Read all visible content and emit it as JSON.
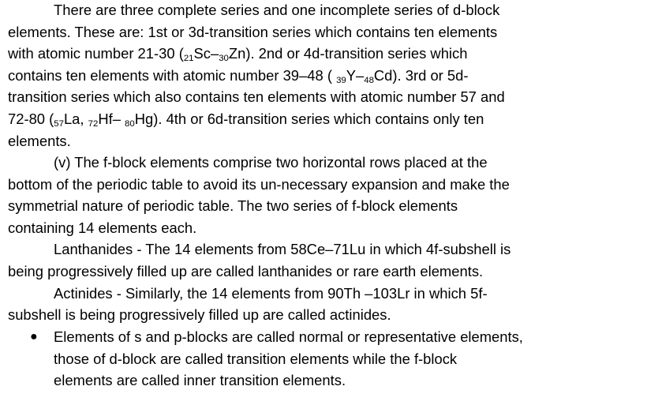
{
  "paragraph1": {
    "l1": "There are three complete series and one incomplete series of d-block",
    "l2": "elements. These are: 1st or 3d-transition series which contains ten elements",
    "l3_a": "with atomic number 21-30 (",
    "l3_s1": "21",
    "l3_b": "Sc–",
    "l3_s2": "30",
    "l3_c": "Zn). 2nd or 4d-transition series which",
    "l4_a": "contains ten elements with atomic number 39–48 ( ",
    "l4_s1": "39",
    "l4_b": "Y–",
    "l4_s2": "48",
    "l4_c": "Cd). 3rd or 5d-",
    "l5": "transition series which also contains ten elements with atomic number 57 and",
    "l6_a": "72-80 (",
    "l6_s1": "57",
    "l6_b": "La, ",
    "l6_s2": "72",
    "l6_c": "Hf– ",
    "l6_s3": "80",
    "l6_d": "Hg). 4th or 6d-transition series which contains only ten",
    "l7": "elements."
  },
  "paragraph2": {
    "l1": "(v) The f-block elements comprise two horizontal rows placed at the",
    "l2": "bottom of the periodic table to avoid its un-necessary expansion and make the",
    "l3": "symmetrial nature of periodic table. The two series of f-block elements",
    "l4": "containing 14 elements each."
  },
  "paragraph3": {
    "l1": "Lanthanides - The 14 elements from 58Ce–71Lu in which 4f-subshell is",
    "l2": "being progressively filled up are called lanthanides or rare earth elements."
  },
  "paragraph4": {
    "l1": "Actinides - Similarly, the 14 elements from 90Th –103Lr in which 5f-",
    "l2": "subshell is being progressively filled up are called actinides."
  },
  "bullet": {
    "symbol": "●",
    "l1": "Elements of s and p-blocks are called normal or representative elements,",
    "l2": "those of d-block are called transition elements while the f-block",
    "l3": "elements are called inner transition elements."
  }
}
